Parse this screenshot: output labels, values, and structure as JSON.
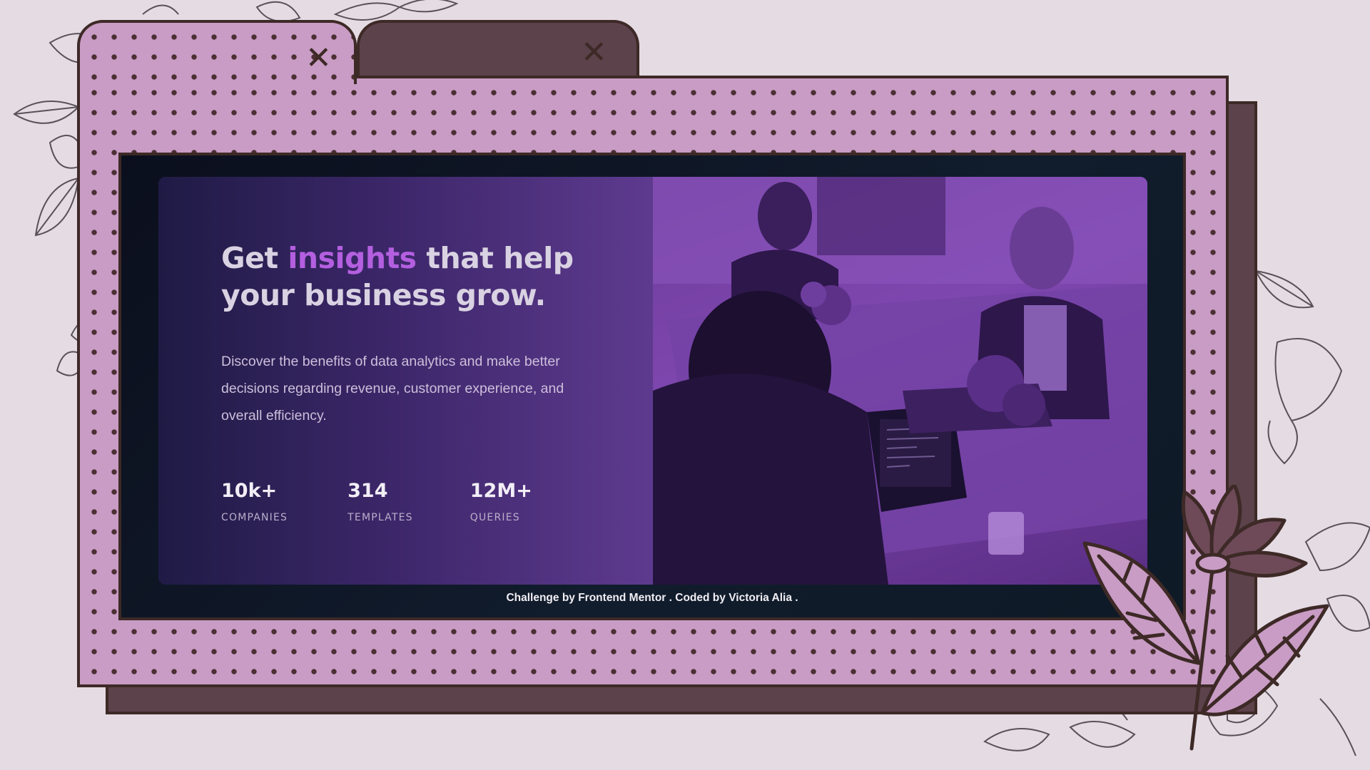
{
  "tabs": [
    {
      "close_icon": "close-icon",
      "active": true
    },
    {
      "close_icon": "close-icon",
      "active": false
    }
  ],
  "card": {
    "headline_part1": "Get ",
    "headline_accent": "insights",
    "headline_part2": " that help your business grow.",
    "description": "Discover the benefits of data analytics and make better decisions regarding revenue, customer experience, and overall efficiency.",
    "stats": [
      {
        "value": "10k+",
        "label": "COMPANIES"
      },
      {
        "value": "314",
        "label": "TEMPLATES"
      },
      {
        "value": "12M+",
        "label": "QUERIES"
      }
    ]
  },
  "attribution": {
    "prefix": "Challenge by ",
    "link1": "Frontend Mentor",
    "middle": ". Coded by ",
    "link2": "Victoria Alia",
    "suffix": "."
  },
  "colors": {
    "background": "#e4dbe3",
    "folder_pink": "#c89cc4",
    "folder_dark": "#5c424b",
    "outline": "#3d2926",
    "accent": "#b45fe0",
    "card_text_bg_start": "#1f1b45",
    "card_text_bg_end": "#5e3a8f"
  },
  "icons": {
    "tab_close": "close-icon",
    "decoration": "flower-icon"
  }
}
